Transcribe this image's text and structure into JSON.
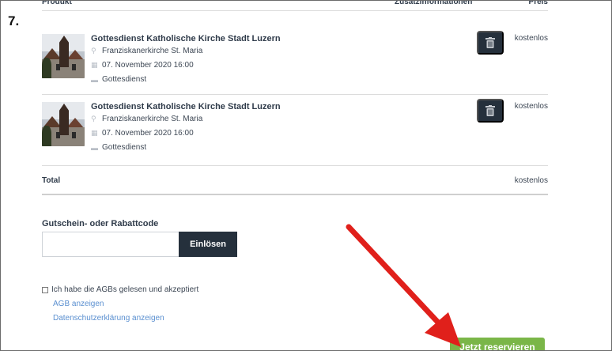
{
  "step": "7.",
  "table": {
    "col_product": "Produkt",
    "col_info": "Zusatzinformationen",
    "col_price": "Preis"
  },
  "items": [
    {
      "title": "Gottesdienst Katholische Kirche Stadt Luzern",
      "location": "Franziskanerkirche St. Maria",
      "datetime": "07. November 2020 16:00",
      "category": "Gottesdienst",
      "price": "kostenlos"
    },
    {
      "title": "Gottesdienst Katholische Kirche Stadt Luzern",
      "location": "Franziskanerkirche St. Maria",
      "datetime": "07. November 2020 16:00",
      "category": "Gottesdienst",
      "price": "kostenlos"
    }
  ],
  "total": {
    "label": "Total",
    "value": "kostenlos"
  },
  "coupon": {
    "label": "Gutschein- oder Rabattcode",
    "value": "",
    "button": "Einlösen"
  },
  "agb": {
    "checkbox_label": "Ich habe die AGBs gelesen und akzeptiert",
    "link_agb": "AGB anzeigen",
    "link_privacy": "Datenschutzerklärung anzeigen"
  },
  "submit_label": "Jetzt reservieren",
  "colors": {
    "dark_button": "#25303c",
    "submit_green": "#7ab648",
    "link_blue": "#5a8fd0",
    "arrow_red": "#e0201b"
  }
}
